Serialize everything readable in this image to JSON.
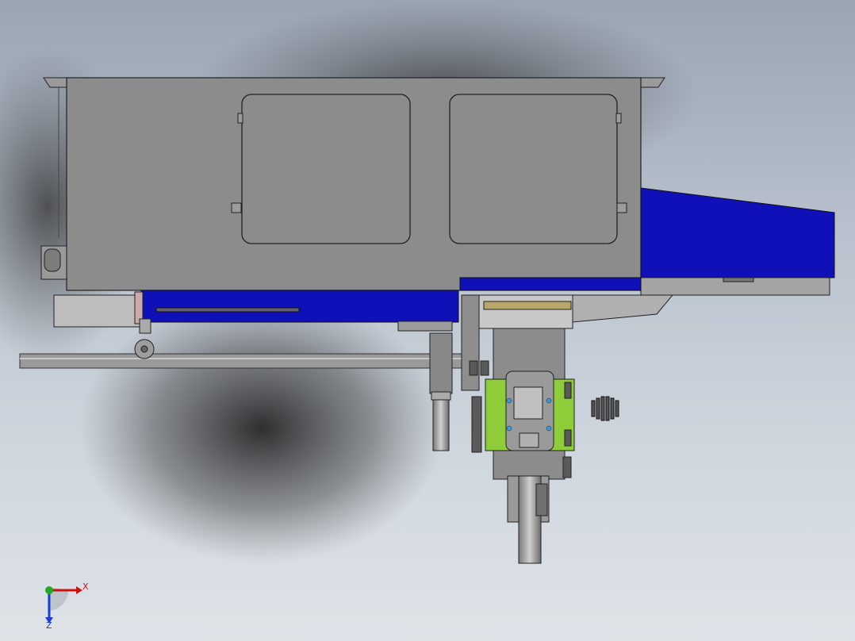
{
  "viewport": {
    "background_top": "#9aa4b3",
    "background_bottom": "#dfe3e8"
  },
  "colors": {
    "housing": "#8c8c8c",
    "housing_edge": "#2a2a2a",
    "belt_blue": "#1010b8",
    "plate_green": "#8fcc3a",
    "steel_light": "#a8a8a8"
  },
  "triad": {
    "x_label": "X",
    "z_label": "Z",
    "x_color": "#cc1111",
    "z_color": "#1a3fd0",
    "origin_color": "#22aa22"
  },
  "parts": {
    "housing": "hopper-housing",
    "access_panel_left": "access-panel",
    "access_panel_right": "access-panel",
    "conveyor": "blue-conveyor-chute",
    "guide_rail": "guide-rail",
    "motor": "gear-motor",
    "cylinder": "pneumatic-cylinder",
    "spring": "compression-spring"
  }
}
